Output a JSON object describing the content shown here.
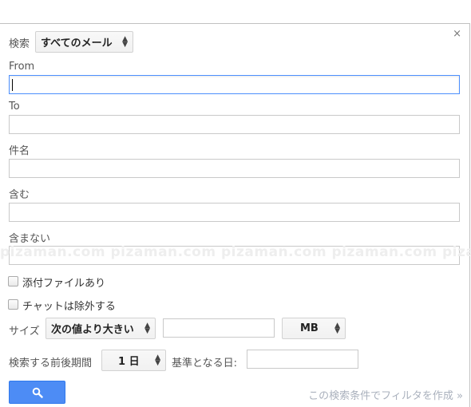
{
  "dialog": {
    "close_glyph": "×",
    "search_label": "検索",
    "scope_value": "すべてのメール",
    "from_label": "From",
    "to_label": "To",
    "subject_label": "件名",
    "includes_label": "含む",
    "excludes_label": "含まない",
    "watermark": "pizaman.com pizaman.com pizaman.com pizaman.com pizaman.com",
    "has_attachment_label": "添付ファイルあり",
    "exclude_chats_label": "チャットは除外する",
    "size_label": "サイズ",
    "size_operator": "次の値より大きい",
    "size_unit": "MB",
    "date_within_label": "検索する前後期間",
    "date_within_value": "1 日",
    "date_of_label": "基準となる日:",
    "filter_link": "この検索条件でフィルタを作成 »",
    "colors": {
      "primary_button": "#4d8cf5",
      "focus_border": "#4d90fe",
      "link": "#aab1bd"
    }
  }
}
